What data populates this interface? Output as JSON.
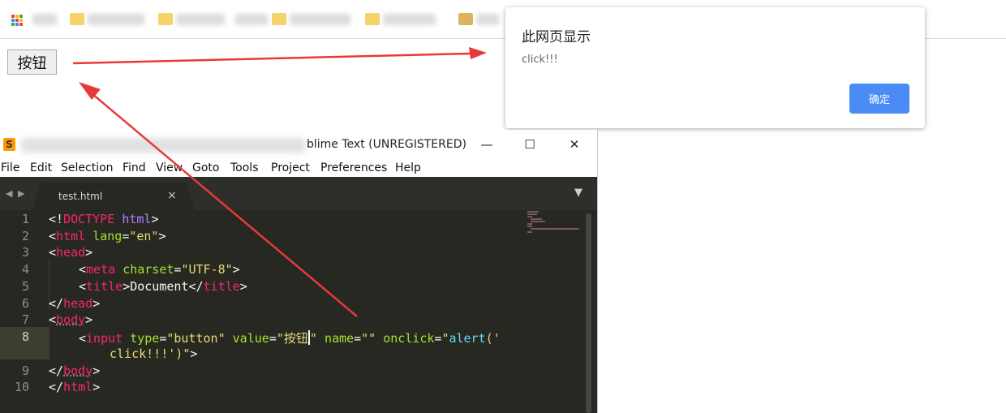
{
  "page": {
    "button_label": "按钮"
  },
  "alert": {
    "title": "此网页显示",
    "message": "click!!!",
    "ok_label": "确定"
  },
  "sublime": {
    "title_suffix": "blime Text (UNREGISTERED)",
    "window_controls": [
      "—",
      "☐",
      "✕"
    ],
    "menu": [
      "File",
      "Edit",
      "Selection",
      "Find",
      "View",
      "Goto",
      "Tools",
      "Project",
      "Preferences",
      "Help"
    ],
    "tab": {
      "label": "test.html",
      "close": "×"
    },
    "nav_arrows": [
      "◀",
      "▶"
    ],
    "dropdown": "▼",
    "line_numbers": [
      "1",
      "2",
      "3",
      "4",
      "5",
      "6",
      "7",
      "8",
      "",
      "9",
      "10"
    ],
    "code": {
      "l1": [
        "<!",
        "DOCTYPE",
        " ",
        "html",
        ">"
      ],
      "l2": [
        "<",
        "html",
        " ",
        "lang",
        "=",
        "\"en\"",
        ">"
      ],
      "l3": [
        "<",
        "head",
        ">"
      ],
      "l4": [
        "<",
        "meta",
        " ",
        "charset",
        "=",
        "\"UTF-8\"",
        ">"
      ],
      "l5": [
        "<",
        "title",
        ">",
        "Document",
        "</",
        "title",
        ">"
      ],
      "l6": [
        "</",
        "head",
        ">"
      ],
      "l7": [
        "<",
        "body",
        ">"
      ],
      "l8a": [
        "<",
        "input",
        " ",
        "type",
        "=",
        "\"button\"",
        " ",
        "value",
        "=",
        "\"按钮",
        "\"",
        " ",
        "name",
        "=",
        "\"\"",
        " ",
        "onclick",
        "=",
        "\"",
        "alert",
        "('"
      ],
      "l8b": [
        "click!!!')",
        "\"",
        ">"
      ],
      "l9": [
        "</",
        "body",
        ">"
      ],
      "l10": [
        "</",
        "html",
        ">"
      ]
    }
  },
  "colors": {
    "editor_bg": "#272822",
    "tag": "#f92672",
    "attr": "#a6e22e",
    "string": "#e6db74",
    "keyword": "#66d9ef",
    "alert_button": "#4a8bf5",
    "arrow": "#e8393a"
  }
}
